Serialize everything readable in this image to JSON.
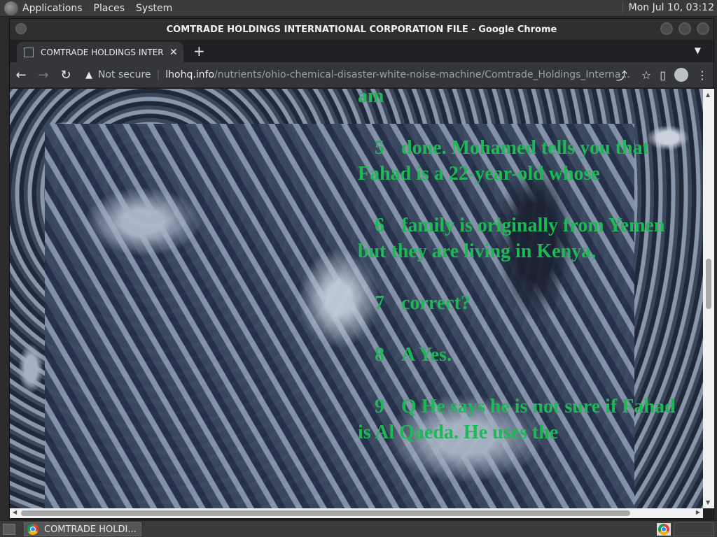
{
  "top_panel": {
    "menus": [
      "Applications",
      "Places",
      "System"
    ],
    "clock": "Mon Jul 10, 03:12"
  },
  "window": {
    "title": "COMTRADE HOLDINGS INTERNATIONAL CORPORATION FILE - Google Chrome"
  },
  "tab": {
    "title": "COMTRADE HOLDINGS INTER",
    "close": "✕",
    "new_tab": "+"
  },
  "toolbar": {
    "not_secure": "Not secure",
    "url_host": "lhohq.info",
    "url_path": "/nutrients/ohio-chemical-disaster-white-noise-machine/Comtrade_Holdings_Interna..."
  },
  "content": {
    "top_fragment": "am",
    "lines": [
      {
        "num": "5",
        "text": "done.  Mohamed tells you that Fahad is a 22-year-old whose"
      },
      {
        "num": "6",
        "text": "family is originally from Yemen but they are living in Kenya,"
      },
      {
        "num": "7",
        "text": "correct?"
      },
      {
        "num": "8",
        "text": "A   Yes."
      },
      {
        "num": "9",
        "text": "Q   He says he is not sure if Fahad is Al Qaeda.  He uses the"
      }
    ]
  },
  "taskbar": {
    "task_label": "COMTRADE HOLDI..."
  },
  "colors": {
    "text_green": "#1db954",
    "chrome_dark": "#202124",
    "toolbar": "#35363a"
  }
}
